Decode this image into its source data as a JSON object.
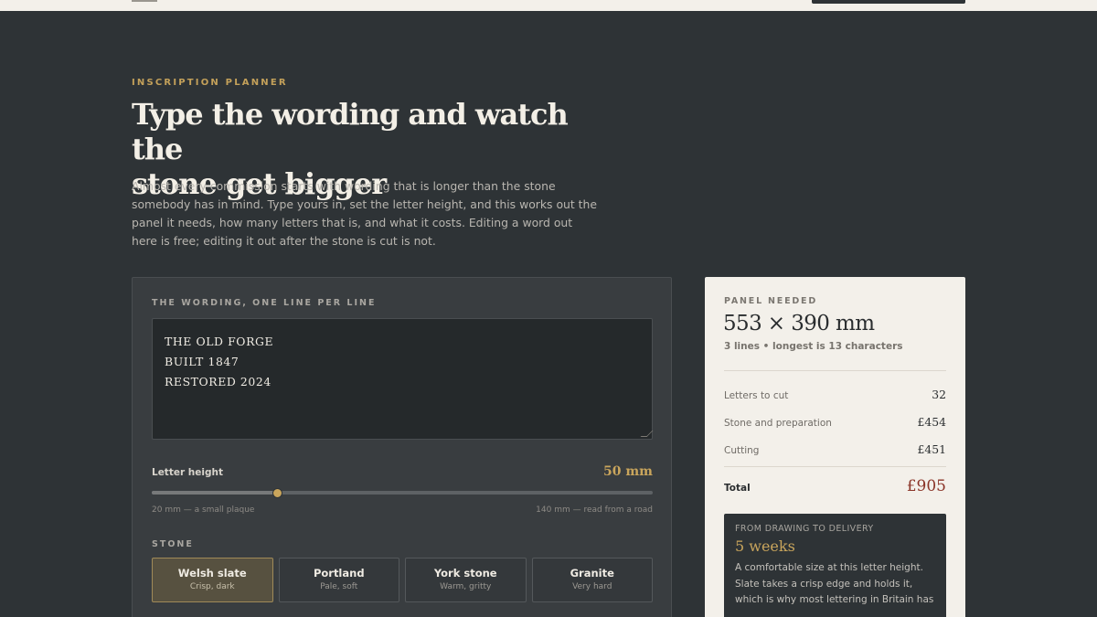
{
  "hero": {
    "eyebrow": "INSCRIPTION PLANNER",
    "title_line_1": "Type the wording and watch the",
    "title_line_2": "stone get bigger",
    "intro": "Almost every commission starts with wording that is longer than the stone somebody has in mind. Type yours in, set the letter height, and this works out the panel it needs, how many letters that is, and what it costs. Editing a word out here is free; editing it out after the stone is cut is not."
  },
  "wording": {
    "label": "THE WORDING, ONE LINE PER LINE",
    "lines": [
      "THE OLD FORGE",
      "BUILT 1847",
      "RESTORED 2024"
    ]
  },
  "letter_height": {
    "label": "Letter height",
    "value_text": "50 mm",
    "value_mm": 50,
    "min_mm": 20,
    "max_mm": 140,
    "min_caption": "20 mm — a small plaque",
    "max_caption": "140 mm — read from a road"
  },
  "stone": {
    "label": "STONE",
    "options": [
      {
        "name": "Welsh slate",
        "desc": "Crisp, dark",
        "selected": true
      },
      {
        "name": "Portland",
        "desc": "Pale, soft",
        "selected": false
      },
      {
        "name": "York stone",
        "desc": "Warm, gritty",
        "selected": false
      },
      {
        "name": "Granite",
        "desc": "Very hard",
        "selected": false
      }
    ]
  },
  "summary": {
    "eyebrow": "PANEL NEEDED",
    "size": "553 × 390 mm",
    "sub": "3 lines • longest is 13 characters",
    "rows": [
      {
        "label": "Letters to cut",
        "value": "32"
      },
      {
        "label": "Stone and preparation",
        "value": "£454"
      },
      {
        "label": "Cutting",
        "value": "£451"
      }
    ],
    "total_label": "Total",
    "total_value": "£905"
  },
  "delivery": {
    "eyebrow": "FROM DRAWING TO DELIVERY",
    "weeks": "5 weeks",
    "note": "A comfortable size at this letter height. Slate takes a crisp edge and holds it, which is why most lettering in Britain has"
  },
  "colors": {
    "background": "#2e3336",
    "accent": "#c9a55c",
    "total": "#8a3327",
    "card": "#f3f0ea"
  }
}
